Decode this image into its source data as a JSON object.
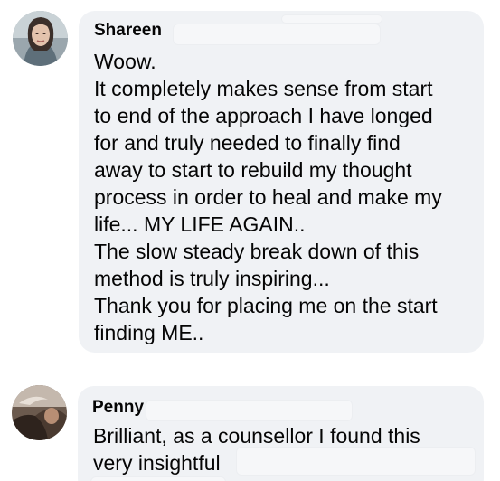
{
  "comments": [
    {
      "author": "Shareen",
      "avatar_icon": "profile-photo",
      "lines": [
        "Woow.",
        "It completely makes sense from start",
        "to end of the approach I have longed",
        "for and truly needed to finally find",
        "away to start to rebuild my thought",
        "process in order to heal and make my",
        "life... MY LIFE AGAIN..",
        "The slow steady break down of this",
        "method is truly inspiring...",
        "Thank you for placing me on the start",
        "finding ME.."
      ]
    },
    {
      "author": "Penny",
      "avatar_icon": "profile-photo",
      "lines": [
        "Brilliant, as a counsellor I found this",
        "very insightful"
      ]
    }
  ],
  "colors": {
    "bubble_bg": "#f0f2f5",
    "text": "#050505",
    "redaction": "#f6f7f9"
  }
}
